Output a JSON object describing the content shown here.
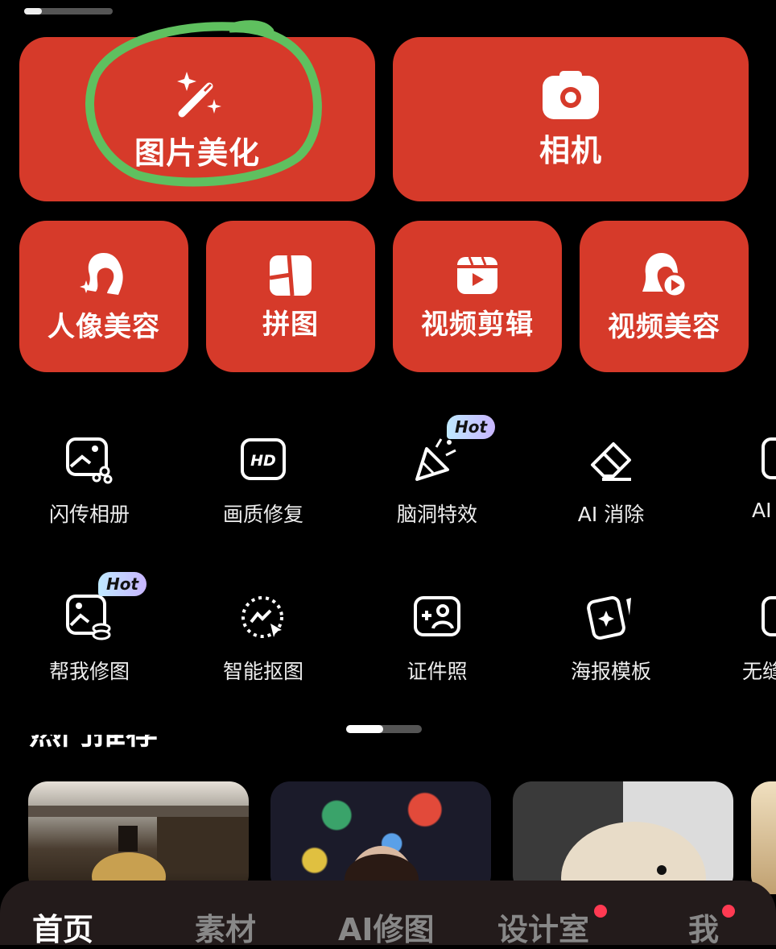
{
  "colors": {
    "card_red": "#d63a2a",
    "background": "#000000",
    "hot_badge": "#c8b5ff",
    "highlight": "#5fc05f",
    "notification_dot": "#ff3a52"
  },
  "main_actions": [
    {
      "label": "图片美化",
      "icon": "magic-wand-icon"
    },
    {
      "label": "相机",
      "icon": "camera-icon"
    }
  ],
  "quick_actions": [
    {
      "label": "人像美容",
      "icon": "portrait-icon"
    },
    {
      "label": "拼图",
      "icon": "collage-icon"
    },
    {
      "label": "视频剪辑",
      "icon": "video-clip-icon"
    },
    {
      "label": "视频美容",
      "icon": "video-beauty-icon"
    }
  ],
  "tools_row1": [
    {
      "label": "闪传相册",
      "icon": "share-album-icon"
    },
    {
      "label": "画质修复",
      "icon": "hd-icon"
    },
    {
      "label": "脑洞特效",
      "icon": "party-popper-icon",
      "badge": "Hot"
    },
    {
      "label": "AI 消除",
      "icon": "eraser-icon"
    },
    {
      "label": "AI",
      "icon": "ai-tool-icon"
    }
  ],
  "tools_row2": [
    {
      "label": "帮我修图",
      "icon": "photo-edit-icon",
      "badge": "Hot"
    },
    {
      "label": "智能抠图",
      "icon": "smart-cutout-icon"
    },
    {
      "label": "证件照",
      "icon": "id-photo-icon"
    },
    {
      "label": "海报模板",
      "icon": "poster-template-icon"
    },
    {
      "label": "无缝",
      "icon": "seamless-icon"
    }
  ],
  "section": {
    "heading": "热门推荐"
  },
  "tabbar": [
    {
      "label": "首页",
      "active": true
    },
    {
      "label": "素材"
    },
    {
      "label": "AI修图"
    },
    {
      "label": "设计室",
      "dot": true
    },
    {
      "label": "我",
      "dot": true
    }
  ]
}
